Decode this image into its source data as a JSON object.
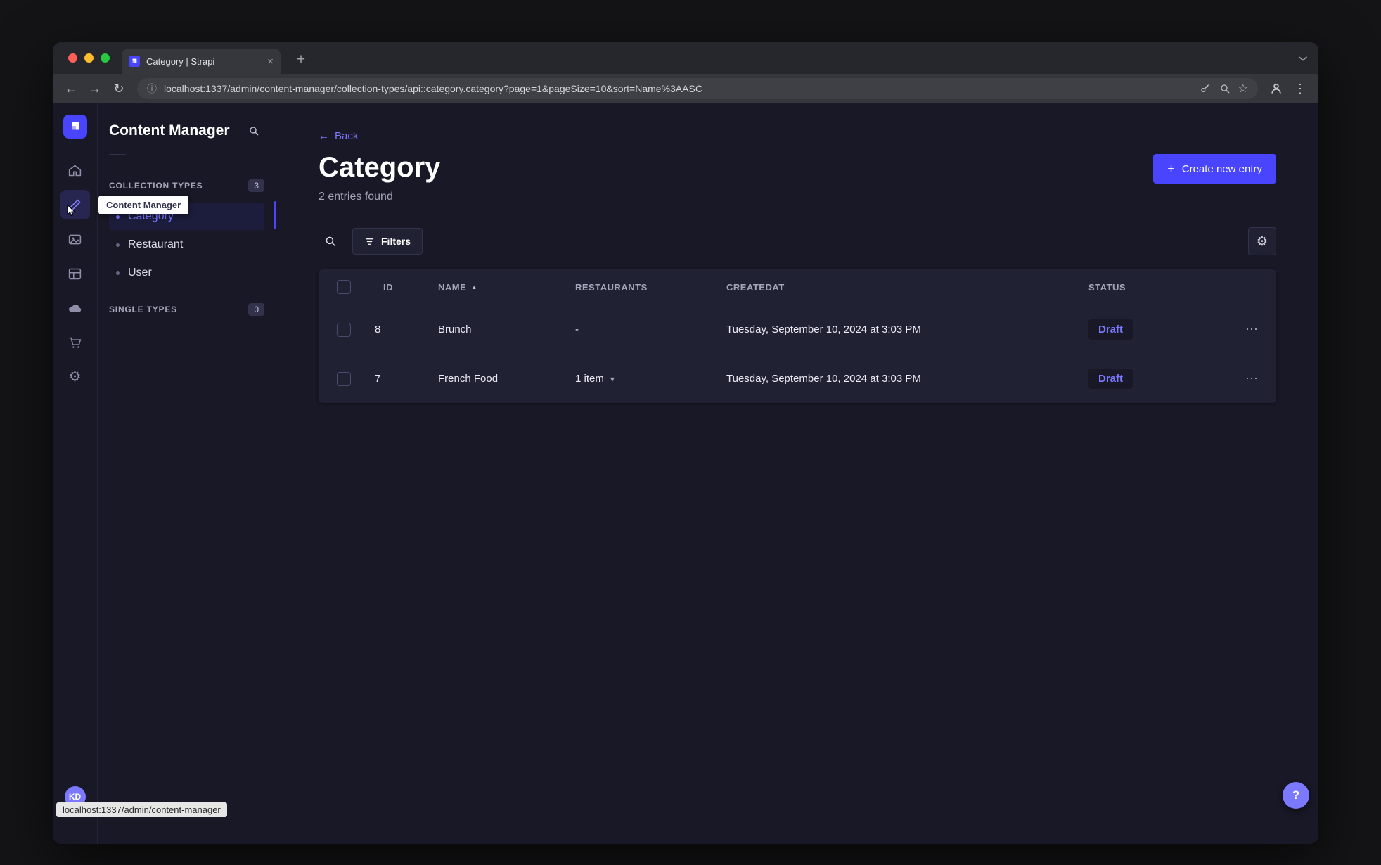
{
  "browser": {
    "tab_title": "Category | Strapi",
    "url": "localhost:1337/admin/content-manager/collection-types/api::category.category?page=1&pageSize=10&sort=Name%3AASC",
    "status_link": "localhost:1337/admin/content-manager"
  },
  "icons": {
    "arrow_left": "←",
    "arrow_right": "→",
    "reload": "↻",
    "info": "ⓘ",
    "star": "☆",
    "menu_v": "⋮",
    "menu_h": "⋯",
    "close": "×",
    "plus": "+",
    "gear": "⚙",
    "caret_up": "▲",
    "chevron_down": "▾"
  },
  "rail": {
    "avatar": "KD",
    "tooltip": "Content Manager"
  },
  "subnav": {
    "title": "Content Manager",
    "sections": [
      {
        "label": "COLLECTION TYPES",
        "badge": "3"
      },
      {
        "label": "SINGLE TYPES",
        "badge": "0"
      }
    ],
    "items": [
      {
        "label": "Category",
        "active": true
      },
      {
        "label": "Restaurant",
        "active": false
      },
      {
        "label": "User",
        "active": false
      }
    ]
  },
  "main": {
    "back": "Back",
    "title": "Category",
    "subtitle": "2 entries found",
    "create_button": "Create new entry",
    "filters": "Filters",
    "help": "?",
    "table": {
      "headers": {
        "id": "ID",
        "name": "NAME",
        "restaurants": "RESTAURANTS",
        "createdat": "CREATEDAT",
        "status": "STATUS"
      },
      "rows": [
        {
          "id": "8",
          "name": "Brunch",
          "restaurants": "-",
          "createdat": "Tuesday, September 10, 2024 at 3:03 PM",
          "status": "Draft"
        },
        {
          "id": "7",
          "name": "French Food",
          "restaurants": "1 item",
          "createdat": "Tuesday, September 10, 2024 at 3:03 PM",
          "status": "Draft"
        }
      ]
    }
  },
  "colors": {
    "primary": "#4945ff",
    "link": "#7b79ff",
    "background": "#181826",
    "surface": "#212134"
  }
}
